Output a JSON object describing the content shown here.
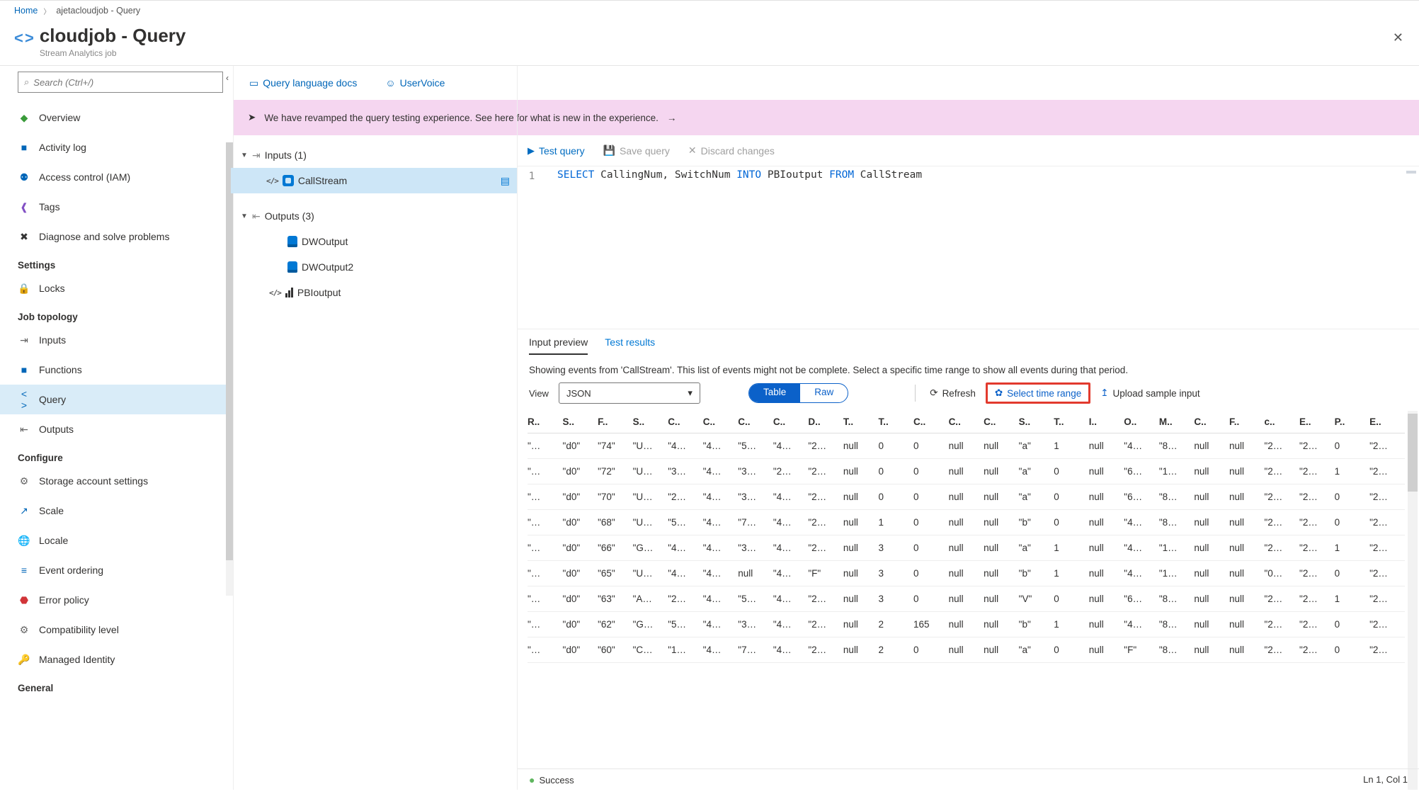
{
  "breadcrumb": {
    "home": "Home",
    "current": "ajetacloudjob - Query"
  },
  "title": {
    "main": "cloudjob - Query",
    "sub": "Stream Analytics job"
  },
  "search": {
    "placeholder": "Search (Ctrl+/)"
  },
  "sidebar": {
    "items_top": [
      {
        "label": "Overview",
        "icon": "◆",
        "cls": "icon-green"
      },
      {
        "label": "Activity log",
        "icon": "■",
        "cls": "icon-blue"
      },
      {
        "label": "Access control (IAM)",
        "icon": "⚉",
        "cls": "icon-blue"
      },
      {
        "label": "Tags",
        "icon": "❰",
        "cls": "icon-purple"
      },
      {
        "label": "Diagnose and solve problems",
        "icon": "✖",
        "cls": "icon-dark"
      }
    ],
    "group_settings": "Settings",
    "items_settings": [
      {
        "label": "Locks",
        "icon": "🔒",
        "cls": "icon-dark"
      }
    ],
    "group_topology": "Job topology",
    "items_topology": [
      {
        "label": "Inputs",
        "icon": "⇥",
        "cls": "icon-gray"
      },
      {
        "label": "Functions",
        "icon": "■",
        "cls": "icon-blue"
      },
      {
        "label": "Query",
        "icon": "< >",
        "cls": "icon-blue",
        "selected": true
      },
      {
        "label": "Outputs",
        "icon": "⇤",
        "cls": "icon-gray"
      }
    ],
    "group_configure": "Configure",
    "items_configure": [
      {
        "label": "Storage account settings",
        "icon": "⚙",
        "cls": "icon-gray"
      },
      {
        "label": "Scale",
        "icon": "↗",
        "cls": "icon-blue"
      },
      {
        "label": "Locale",
        "icon": "🌐",
        "cls": "icon-green"
      },
      {
        "label": "Event ordering",
        "icon": "≡",
        "cls": "icon-blue"
      },
      {
        "label": "Error policy",
        "icon": "⬣",
        "cls": "icon-red"
      },
      {
        "label": "Compatibility level",
        "icon": "⚙",
        "cls": "icon-gray"
      },
      {
        "label": "Managed Identity",
        "icon": "🔑",
        "cls": "icon-orange"
      }
    ],
    "group_general": "General"
  },
  "links": {
    "docs": "Query language docs",
    "uv": "UserVoice"
  },
  "banner": {
    "text": "We have revamped the query testing experience. See here for what is new in the experience.",
    "arrow": "→"
  },
  "tree": {
    "inputs": {
      "label": "Inputs (1)",
      "items": [
        {
          "label": "CallStream",
          "selected": true
        }
      ]
    },
    "outputs": {
      "label": "Outputs (3)",
      "items": [
        {
          "label": "DWOutput",
          "kind": "db"
        },
        {
          "label": "DWOutput2",
          "kind": "db"
        },
        {
          "label": "PBIoutput",
          "kind": "pbi"
        }
      ]
    }
  },
  "editor": {
    "test": "Test query",
    "save": "Save query",
    "discard": "Discard changes",
    "line_no": "1",
    "kw1": "SELECT",
    "seg1": " CallingNum, SwitchNum ",
    "kw2": "INTO",
    "seg2": " PBIoutput ",
    "kw3": "FROM",
    "seg3": " CallStream"
  },
  "preview": {
    "tab1": "Input preview",
    "tab2": "Test results",
    "desc": "Showing events from 'CallStream'. This list of events might not be complete. Select a specific time range to show all events during that period.",
    "view_label": "View",
    "view_value": "JSON",
    "pill_on": "Table",
    "pill_off": "Raw",
    "refresh": "Refresh",
    "range": "Select time range",
    "upload": "Upload sample input",
    "headers": [
      "R..",
      "S..",
      "F..",
      "S..",
      "C..",
      "C..",
      "C..",
      "C..",
      "D..",
      "T..",
      "T..",
      "C..",
      "C..",
      "C..",
      "S..",
      "T..",
      "I..",
      "O..",
      "M..",
      "C..",
      "F..",
      "c..",
      "E..",
      "P..",
      "E.."
    ],
    "rows": [
      [
        "\"…",
        "\"d0\"",
        "\"74\"",
        "\"U…",
        "\"4…",
        "\"4…",
        "\"5…",
        "\"4…",
        "\"2…",
        "null",
        "0",
        "0",
        "null",
        "null",
        "\"a\"",
        "1",
        "null",
        "\"4…",
        "\"8…",
        "null",
        "null",
        "\"2…",
        "\"2…",
        "0",
        "\"2…"
      ],
      [
        "\"…",
        "\"d0\"",
        "\"72\"",
        "\"U…",
        "\"3…",
        "\"4…",
        "\"3…",
        "\"2…",
        "\"2…",
        "null",
        "0",
        "0",
        "null",
        "null",
        "\"a\"",
        "0",
        "null",
        "\"6…",
        "\"1…",
        "null",
        "null",
        "\"2…",
        "\"2…",
        "1",
        "\"2…"
      ],
      [
        "\"…",
        "\"d0\"",
        "\"70\"",
        "\"U…",
        "\"2…",
        "\"4…",
        "\"3…",
        "\"4…",
        "\"2…",
        "null",
        "0",
        "0",
        "null",
        "null",
        "\"a\"",
        "0",
        "null",
        "\"6…",
        "\"8…",
        "null",
        "null",
        "\"2…",
        "\"2…",
        "0",
        "\"2…"
      ],
      [
        "\"…",
        "\"d0\"",
        "\"68\"",
        "\"U…",
        "\"5…",
        "\"4…",
        "\"7…",
        "\"4…",
        "\"2…",
        "null",
        "1",
        "0",
        "null",
        "null",
        "\"b\"",
        "0",
        "null",
        "\"4…",
        "\"8…",
        "null",
        "null",
        "\"2…",
        "\"2…",
        "0",
        "\"2…"
      ],
      [
        "\"…",
        "\"d0\"",
        "\"66\"",
        "\"G…",
        "\"4…",
        "\"4…",
        "\"3…",
        "\"4…",
        "\"2…",
        "null",
        "3",
        "0",
        "null",
        "null",
        "\"a\"",
        "1",
        "null",
        "\"4…",
        "\"1…",
        "null",
        "null",
        "\"2…",
        "\"2…",
        "1",
        "\"2…"
      ],
      [
        "\"…",
        "\"d0\"",
        "\"65\"",
        "\"U…",
        "\"4…",
        "\"4…",
        "null",
        "\"4…",
        "\"F\"",
        "null",
        "3",
        "0",
        "null",
        "null",
        "\"b\"",
        "1",
        "null",
        "\"4…",
        "\"1…",
        "null",
        "null",
        "\"0…",
        "\"2…",
        "0",
        "\"2…"
      ],
      [
        "\"…",
        "\"d0\"",
        "\"63\"",
        "\"A…",
        "\"2…",
        "\"4…",
        "\"5…",
        "\"4…",
        "\"2…",
        "null",
        "3",
        "0",
        "null",
        "null",
        "\"V\"",
        "0",
        "null",
        "\"6…",
        "\"8…",
        "null",
        "null",
        "\"2…",
        "\"2…",
        "1",
        "\"2…"
      ],
      [
        "\"…",
        "\"d0\"",
        "\"62\"",
        "\"G…",
        "\"5…",
        "\"4…",
        "\"3…",
        "\"4…",
        "\"2…",
        "null",
        "2",
        "165",
        "null",
        "null",
        "\"b\"",
        "1",
        "null",
        "\"4…",
        "\"8…",
        "null",
        "null",
        "\"2…",
        "\"2…",
        "0",
        "\"2…"
      ],
      [
        "\"…",
        "\"d0\"",
        "\"60\"",
        "\"C…",
        "\"1…",
        "\"4…",
        "\"7…",
        "\"4…",
        "\"2…",
        "null",
        "2",
        "0",
        "null",
        "null",
        "\"a\"",
        "0",
        "null",
        "\"F\"",
        "\"8…",
        "null",
        "null",
        "\"2…",
        "\"2…",
        "0",
        "\"2…"
      ]
    ],
    "status": "Success",
    "cursor": "Ln 1, Col 1"
  }
}
